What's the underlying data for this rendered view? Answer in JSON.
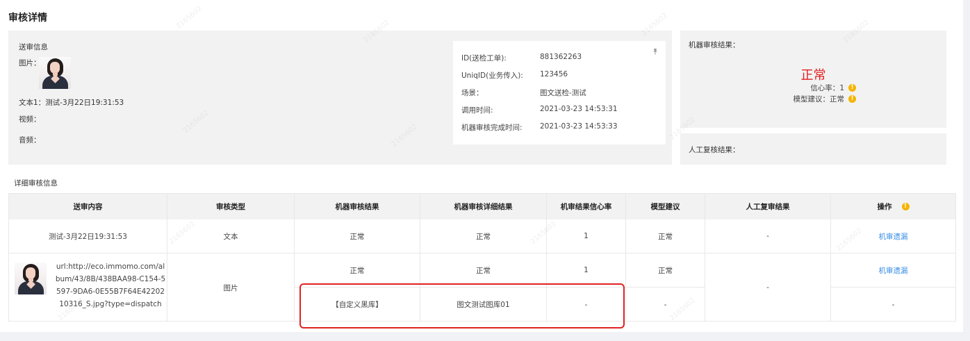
{
  "page": {
    "title": "审核详情"
  },
  "submit_info": {
    "heading": "送审信息",
    "image_label": "图片：",
    "text_label": "文本1：",
    "text_value": "测试-3月22日19:31:53",
    "video_label": "视频：",
    "audio_label": "音频："
  },
  "ticket": {
    "rows": [
      {
        "key": "ID(送检工单):",
        "value": "881362263"
      },
      {
        "key": "UniqID(业务传入):",
        "value": "123456"
      },
      {
        "key": "场景：",
        "value": "图文送检-测试"
      },
      {
        "key": "调用时间:",
        "value": "2021-03-23 14:53:31"
      },
      {
        "key": "机器审核完成时间:",
        "value": "2021-03-23 14:53:33"
      }
    ],
    "pin_icon": "pin-icon"
  },
  "machine_review": {
    "heading": "机器审核结果：",
    "result": "正常",
    "confidence_label": "信心率：",
    "confidence_value": "1",
    "suggestion_label": "模型建议：",
    "suggestion_value": "正常",
    "warn_icon": "!",
    "result_color": "#e02020"
  },
  "human_review": {
    "heading": "人工复核结果："
  },
  "detail_section": {
    "label": "详细审核信息"
  },
  "table": {
    "headers": [
      "送审内容",
      "审核类型",
      "机器审核结果",
      "机器审核详细结果",
      "机审结果信心率",
      "模型建议",
      "人工复审结果",
      "操作"
    ],
    "header_warn_icon": "!",
    "row1": {
      "content": "测试-3月22日19:31:53",
      "type": "文本",
      "machine_result": "正常",
      "machine_detail": "正常",
      "confidence": "1",
      "suggestion": "正常",
      "human_result": "-",
      "action": "机审遗漏"
    },
    "row2": {
      "url": "url:http://eco.immomo.com/album/43/8B/438BAA98-C154-5597-9DA6-0E55B7F64E4220210316_S.jpg?type=dispatch",
      "type": "图片",
      "human_result": "-",
      "sub1": {
        "machine_result": "正常",
        "machine_detail": "正常",
        "confidence": "1",
        "suggestion": "正常",
        "action": "机审遗漏"
      },
      "sub2": {
        "machine_result": "【自定义黑库】",
        "machine_detail": "图文测试图库01",
        "confidence": "-",
        "suggestion": "-",
        "action": "-"
      }
    }
  },
  "accent": {
    "link": "#3a8ee6",
    "warn": "#f5b400",
    "highlight": "#e02222"
  }
}
